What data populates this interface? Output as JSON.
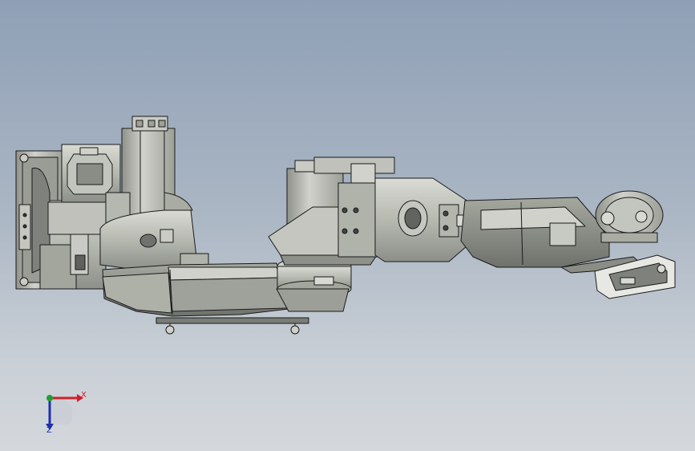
{
  "viewport": {
    "background_top": "#8fa0b6",
    "background_bottom": "#d4d8dc"
  },
  "model": {
    "part_fill": "#b9bcb3",
    "part_fill_dark": "#8e918a",
    "part_fill_light": "#d7d9d2",
    "edge_color": "#1a1a1a"
  },
  "triad": {
    "x_label": "X",
    "z_label": "Z",
    "x_color": "#d0202a",
    "y_color": "#22a030",
    "z_color": "#1d2fb0"
  }
}
